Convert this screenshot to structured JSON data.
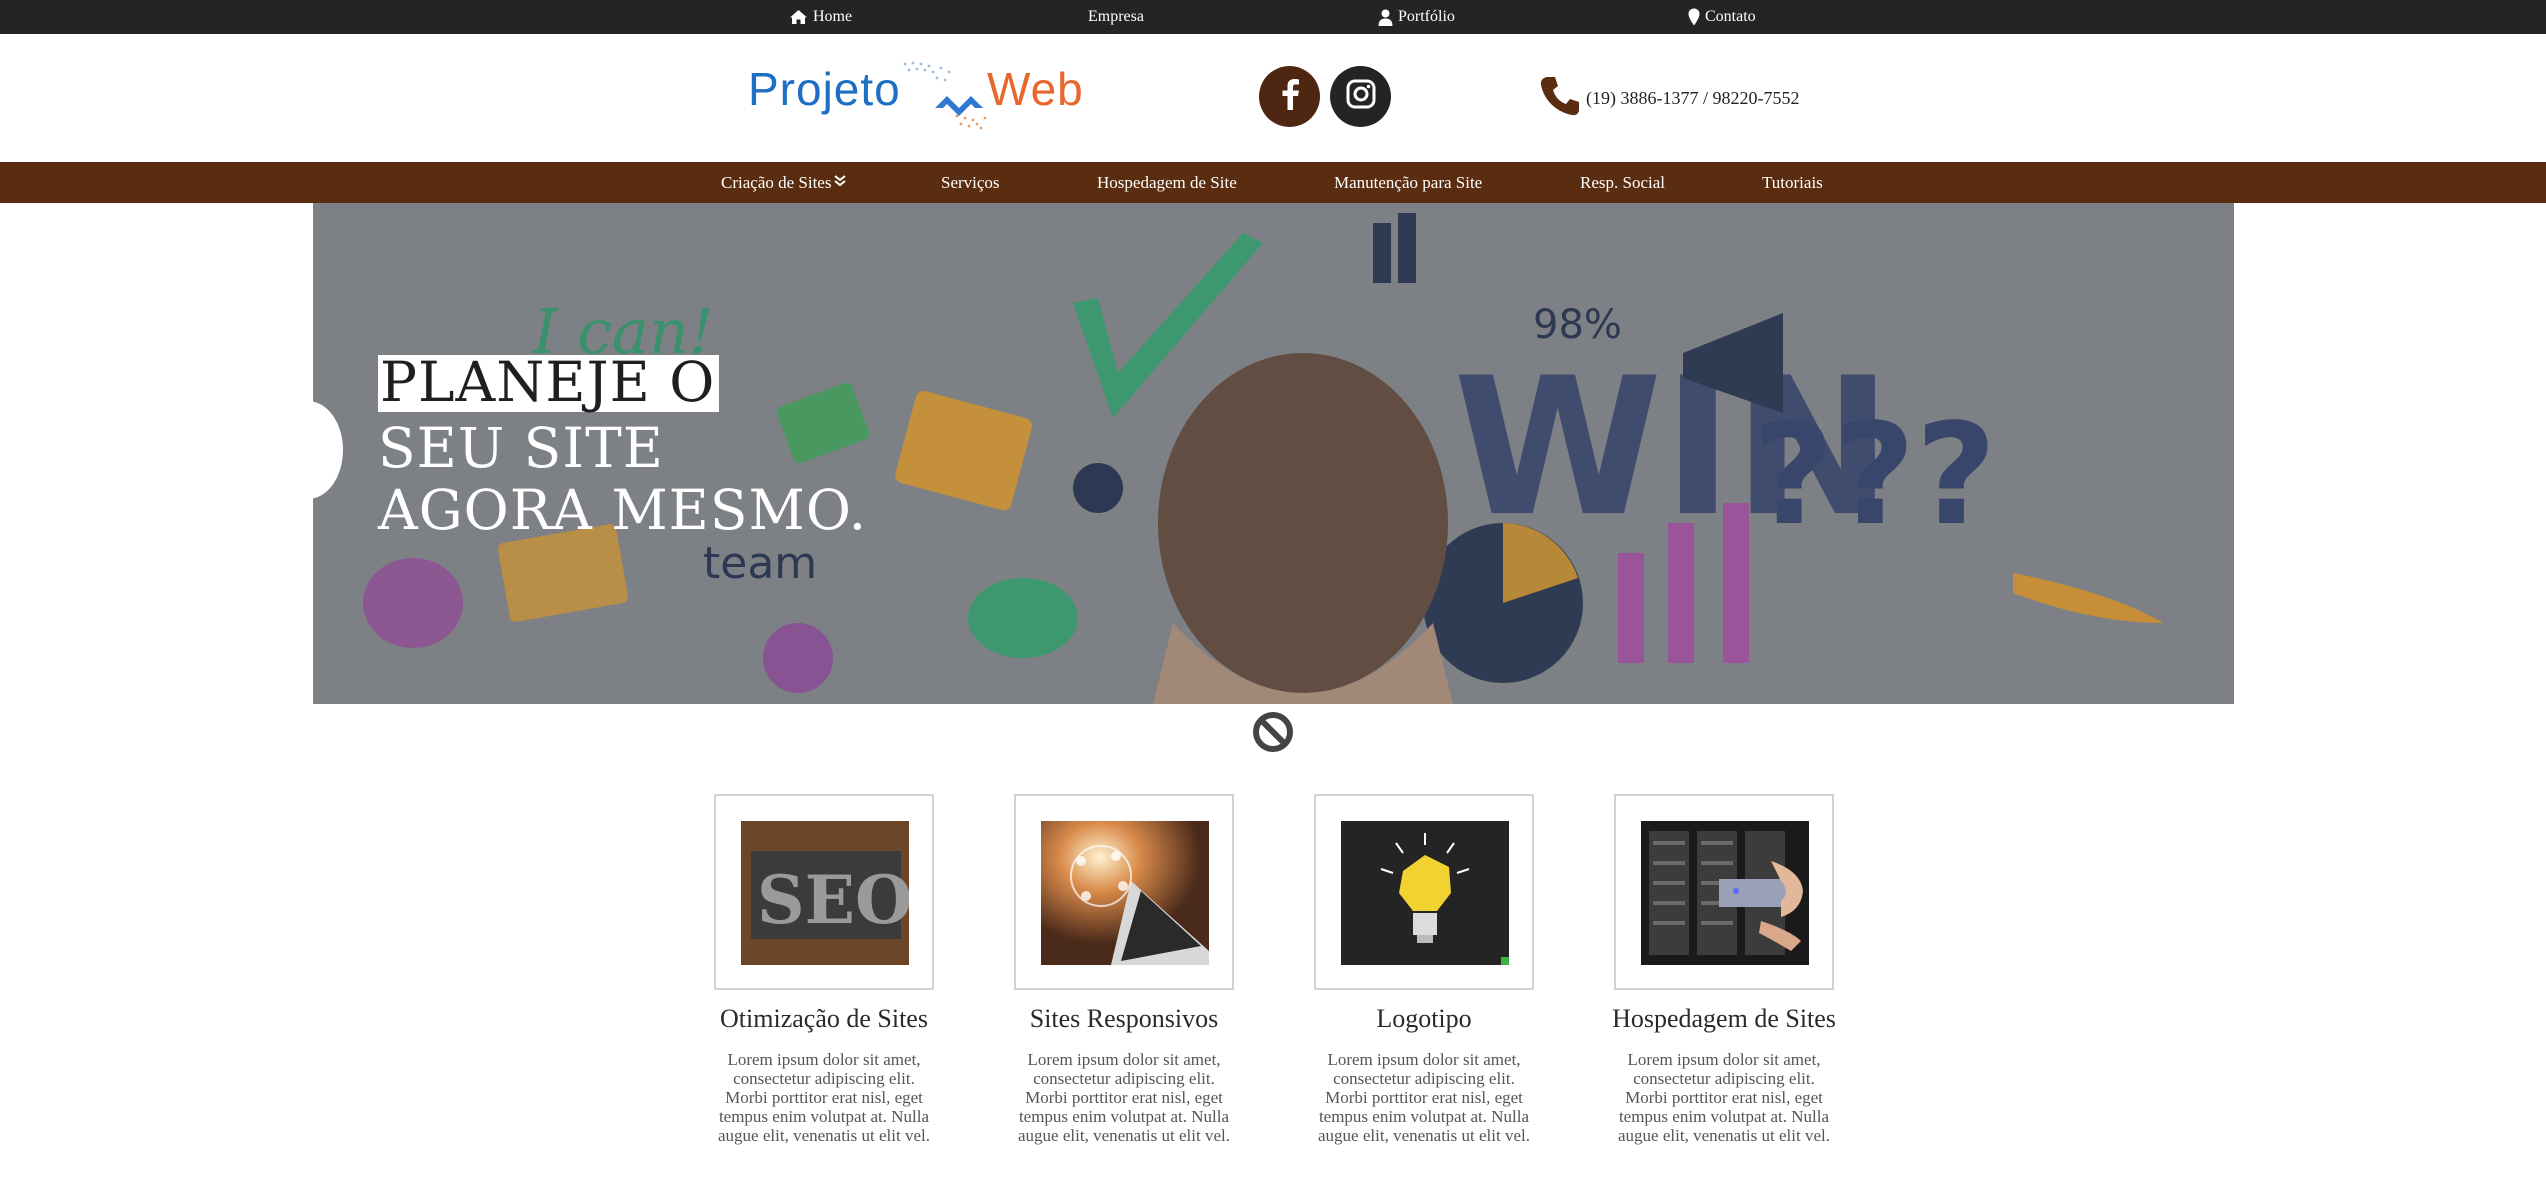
{
  "top_nav": {
    "items": [
      {
        "label": "Home",
        "icon": "home-icon"
      },
      {
        "label": "Empresa",
        "icon": ""
      },
      {
        "label": "Portfólio",
        "icon": "user-icon"
      },
      {
        "label": "Contato",
        "icon": "map-pin-icon"
      }
    ]
  },
  "header": {
    "logo": {
      "part1": "Projeto",
      "part2": "Web"
    },
    "social": [
      {
        "name": "facebook",
        "icon": "facebook-icon"
      },
      {
        "name": "instagram",
        "icon": "instagram-icon"
      }
    ],
    "phone": {
      "icon": "phone-icon",
      "text": "(19) 3886-1377 / 98220-7552"
    }
  },
  "main_nav": {
    "items": [
      {
        "label": "Criação de Sites",
        "has_dropdown": true
      },
      {
        "label": "Serviços"
      },
      {
        "label": "Hospedagem de Site"
      },
      {
        "label": "Manutenção para Site"
      },
      {
        "label": "Resp. Social"
      },
      {
        "label": "Tutoriais"
      }
    ]
  },
  "hero": {
    "line1": "PLANEJE O",
    "line2": "SEU SITE",
    "line3": "AGORA MESMO.",
    "art_text": {
      "ican": "I can!",
      "win": "WIN",
      "team": "team",
      "percent": "98%",
      "questions": "???"
    }
  },
  "features": [
    {
      "title": "Otimização de Sites",
      "image_text": "SEO",
      "text": "Lorem ipsum dolor sit amet, consectetur adipiscing elit. Morbi porttitor erat nisl, eget tempus enim volutpat at. Nulla augue elit, venenatis ut elit vel."
    },
    {
      "title": "Sites Responsivos",
      "image_text": "",
      "text": "Lorem ipsum dolor sit amet, consectetur adipiscing elit. Morbi porttitor erat nisl, eget tempus enim volutpat at. Nulla augue elit, venenatis ut elit vel."
    },
    {
      "title": "Logotipo",
      "image_text": "",
      "text": "Lorem ipsum dolor sit amet, consectetur adipiscing elit. Morbi porttitor erat nisl, eget tempus enim volutpat at. Nulla augue elit, venenatis ut elit vel."
    },
    {
      "title": "Hospedagem de Sites",
      "image_text": "",
      "text": "Lorem ipsum dolor sit amet, consectetur adipiscing elit. Morbi porttitor erat nisl, eget tempus enim volutpat at. Nulla augue elit, venenatis ut elit vel."
    }
  ],
  "colors": {
    "top_bar": "#242424",
    "main_nav": "#5a2c10",
    "facebook_bg": "#4e2612",
    "instagram_bg": "#242424",
    "logo_blue": "#1c6fc2",
    "logo_orange": "#e9662d"
  }
}
